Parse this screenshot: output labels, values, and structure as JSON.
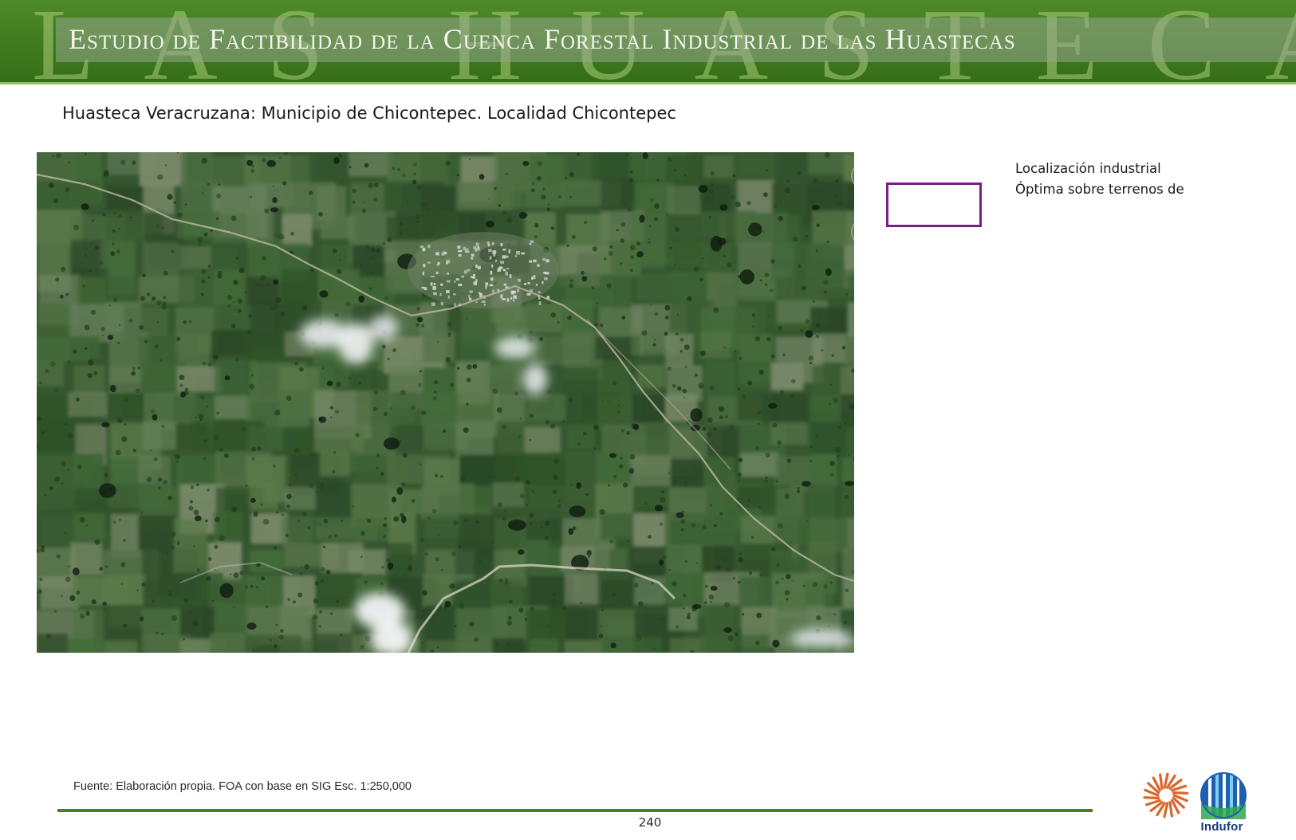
{
  "header": {
    "watermark": "LAS HUASTECAS",
    "title": "Estudio de Factibilidad de la Cuenca Forestal Industrial de las Huastecas"
  },
  "page": {
    "title": "Huasteca Veracruzana: Municipio de Chicontepec. Localidad Chicontepec"
  },
  "legend": {
    "swatch_color": "#7a1e86",
    "lines": [
      "Localización industrial",
      "Óptima sobre terrenos de"
    ]
  },
  "footer": {
    "source": "Fuente: Elaboración propia. FOA con base en SIG Esc. 1:250,000",
    "page_number": "240",
    "logo_text": "Indufor",
    "sun_logo_color": "#d9652b",
    "indufor_logo_color": "#1e5fb0"
  },
  "colors": {
    "banner_green": "#3f7a1f",
    "rule_green": "#4b7d22"
  }
}
